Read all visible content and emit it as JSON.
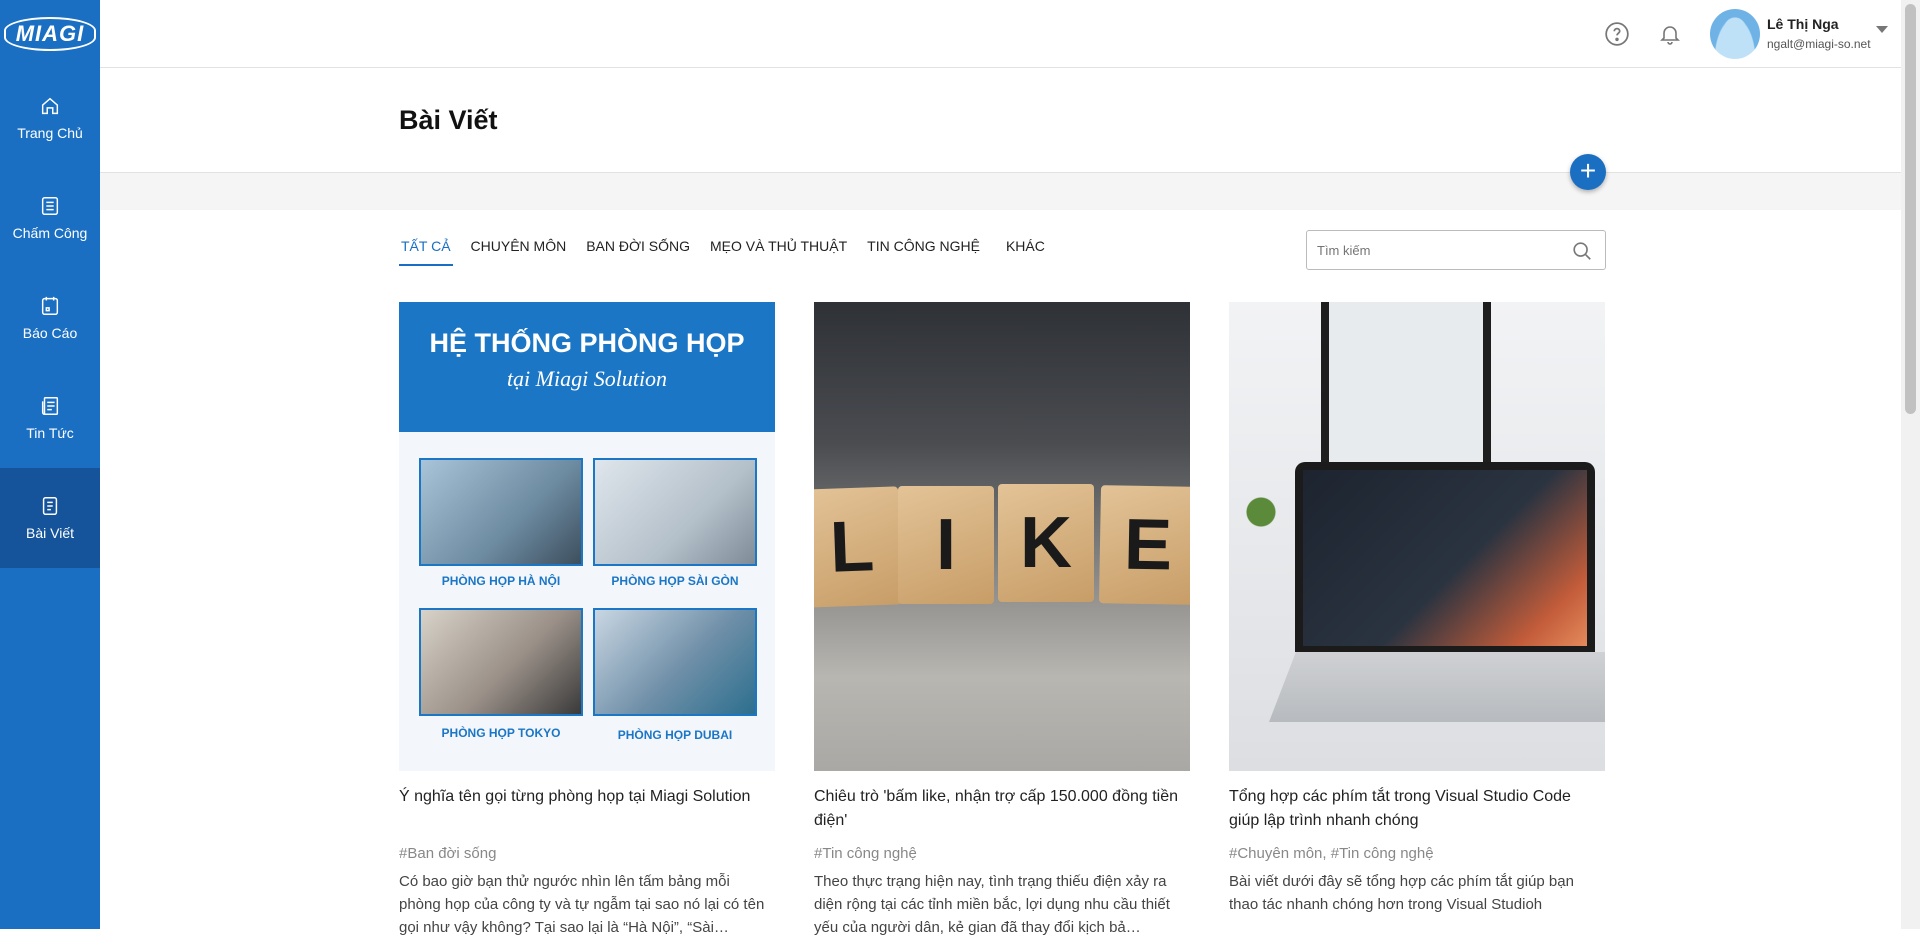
{
  "app": {
    "logo_text": "MIAGI"
  },
  "sidebar": {
    "items": [
      {
        "label": "Trang Chủ",
        "icon": "home-icon"
      },
      {
        "label": "Chấm Công",
        "icon": "checklist-icon"
      },
      {
        "label": "Báo Cáo",
        "icon": "report-icon"
      },
      {
        "label": "Tin Tức",
        "icon": "news-icon"
      },
      {
        "label": "Bài Viết",
        "icon": "article-icon",
        "active": true
      }
    ]
  },
  "header": {
    "user_name": "Lê Thị Nga",
    "user_email": "ngalt@miagi-so.net"
  },
  "page": {
    "title": "Bài Viết",
    "add_label": "+"
  },
  "tabs": [
    {
      "label": "TẤT CẢ",
      "active": true
    },
    {
      "label": "CHUYÊN MÔN"
    },
    {
      "label": "BAN ĐỜI SỐNG"
    },
    {
      "label": "MẸO VÀ THỦ THUẬT"
    },
    {
      "label": "TIN CÔNG NGHỆ"
    },
    {
      "label": "KHÁC"
    }
  ],
  "search": {
    "placeholder": "Tìm kiếm"
  },
  "thumb1": {
    "heading": "HỆ THỐNG PHÒNG HỌP",
    "subheading": "tại Miagi Solution",
    "rooms": [
      "PHÒNG HỌP HÀ NỘI",
      "PHÒNG HỌP SÀI GÒN",
      "PHÒNG HỌP TOKYO",
      "PHÒNG HỌP DUBAI"
    ]
  },
  "thumb2": {
    "letters": [
      "L",
      "I",
      "K",
      "E"
    ]
  },
  "posts": [
    {
      "title": "Ý nghĩa tên gọi từng phòng họp tại Miagi Solution",
      "tags": "#Ban đời sống",
      "desc": "Có bao giờ bạn thử ngước nhìn lên tấm bảng mỗi phòng họp của công ty và tự ngẫm tại sao nó lại có tên gọi như vậy không? Tại sao lại là “Hà Nội”, “Sài…"
    },
    {
      "title": "Chiêu trò 'bấm like, nhận trợ cấp 150.000 đồng tiền điện'",
      "tags": "#Tin công nghệ",
      "desc": "Theo thực trạng hiện nay, tình trạng thiếu điện xảy ra diện rộng tại các tỉnh miền bắc, lợi dụng nhu cầu thiết yếu của người dân, kẻ gian đã thay đổi kịch bả…"
    },
    {
      "title": "Tổng hợp các phím tắt trong Visual Studio Code giúp lập trình nhanh chóng",
      "tags": "#Chuyên môn, #Tin công nghệ",
      "desc": "Bài viết dưới đây sẽ tổng hợp các phím tắt giúp bạn thao tác nhanh chóng hơn trong Visual Studioh"
    }
  ]
}
